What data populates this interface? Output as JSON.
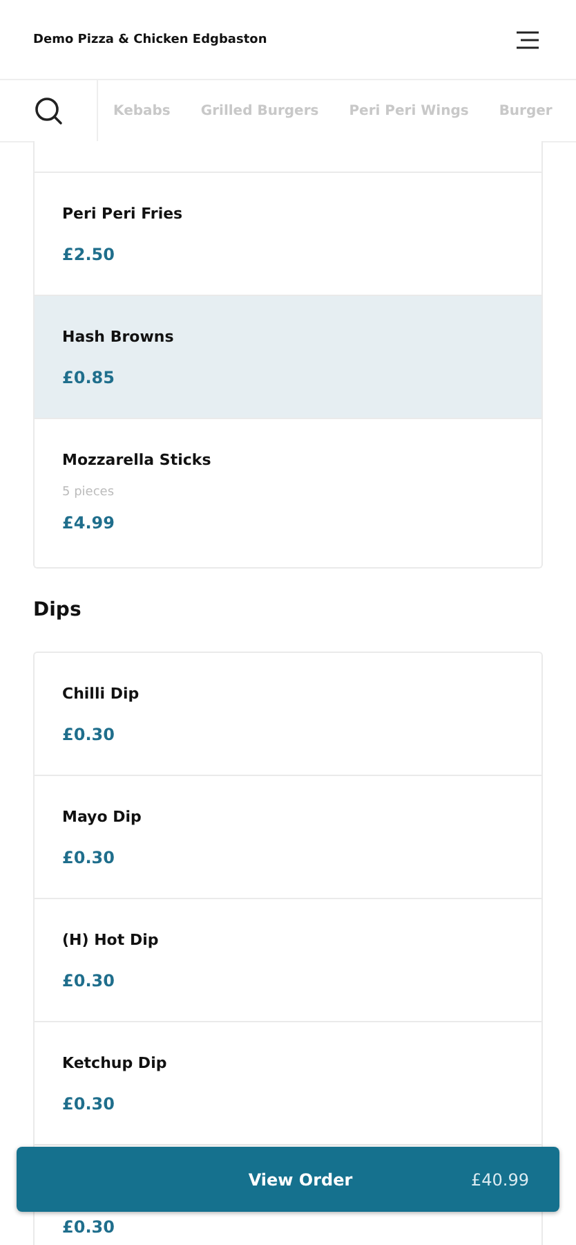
{
  "header": {
    "title": "Demo Pizza & Chicken Edgbaston"
  },
  "categories": [
    {
      "label": "Kebabs",
      "selected": false
    },
    {
      "label": "Grilled Burgers",
      "selected": false
    },
    {
      "label": "Peri Peri Wings",
      "selected": false
    },
    {
      "label": "Burger",
      "selected": false
    }
  ],
  "sections": [
    {
      "items": [
        {
          "name": "Peri Peri Fries",
          "price": "£2.50",
          "highlighted": false
        },
        {
          "name": "Hash Browns",
          "price": "£0.85",
          "highlighted": true
        },
        {
          "name": "Mozzarella Sticks",
          "description": "5 pieces",
          "price": "£4.99",
          "highlighted": false
        }
      ]
    },
    {
      "title": "Dips",
      "items": [
        {
          "name": "Chilli Dip",
          "price": "£0.30",
          "highlighted": false
        },
        {
          "name": "Mayo Dip",
          "price": "£0.30",
          "highlighted": false
        },
        {
          "name": "(H) Hot Dip",
          "price": "£0.30",
          "highlighted": false
        },
        {
          "name": "Ketchup Dip",
          "price": "£0.30",
          "highlighted": false
        },
        {
          "price": "£0.30"
        }
      ]
    }
  ],
  "order_bar": {
    "label": "View Order",
    "total": "£40.99"
  }
}
